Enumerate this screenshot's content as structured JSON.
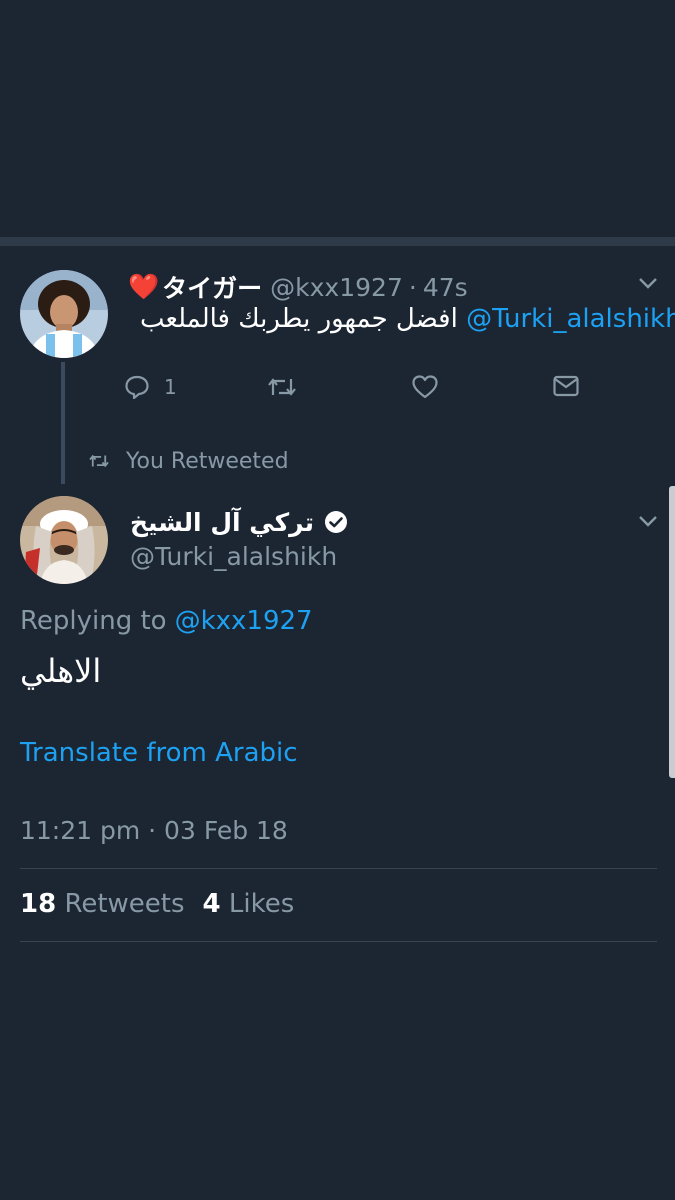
{
  "reply_tweet": {
    "display_name": "タイガー",
    "display_name_emoji": "❤️",
    "handle": "@kxx1927",
    "separator": "·",
    "time_ago": "47s",
    "body_mention": "@Turki_alalshikh",
    "body_text": "افضل جمهور يطربك فالملعب",
    "reply_count": "1",
    "icons": [
      "reply-icon",
      "retweet-icon",
      "like-icon",
      "direct-message-icon",
      "chevron-down-icon"
    ]
  },
  "retweet_context": {
    "text": "You Retweeted",
    "icon": "retweet-icon"
  },
  "main_tweet": {
    "display_name": "تركي آل الشيخ",
    "verified": true,
    "handle": "@Turki_alalshikh",
    "replying_to_label": "Replying to",
    "replying_to_handle": "@kxx1927",
    "body": "الاهلي",
    "translate_label": "Translate from Arabic",
    "timestamp": "11:21 pm · 03 Feb 18",
    "retweets_count": "18",
    "retweets_label": "Retweets",
    "likes_count": "4",
    "likes_label": "Likes"
  },
  "colors": {
    "background": "#1c2532",
    "link": "#1da1f2",
    "muted": "#8899a6",
    "heart": "#e0245e"
  }
}
